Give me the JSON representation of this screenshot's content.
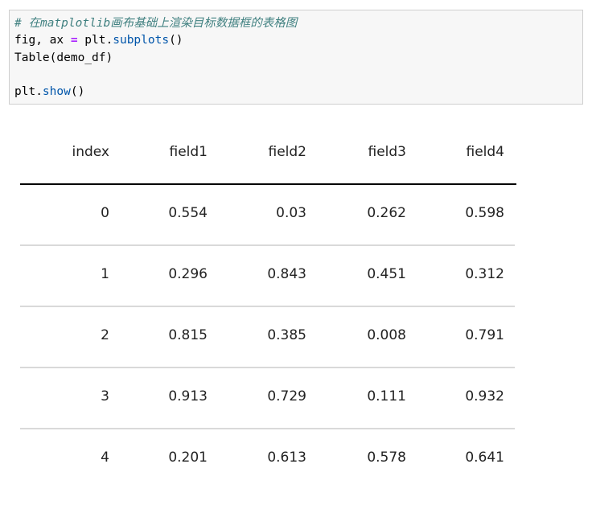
{
  "code": {
    "comment": "# 在matplotlib画布基础上渲染目标数据框的表格图",
    "line2_a": "fig, ax ",
    "line2_op": "=",
    "line2_b": " plt.",
    "line2_fn": "subplots",
    "line2_c": "()",
    "line3": "Table(demo_df)",
    "line5_a": "plt.",
    "line5_fn": "show",
    "line5_c": "()"
  },
  "table": {
    "headers": [
      "index",
      "field1",
      "field2",
      "field3",
      "field4"
    ],
    "rows": [
      [
        "0",
        "0.554",
        "0.03",
        "0.262",
        "0.598"
      ],
      [
        "1",
        "0.296",
        "0.843",
        "0.451",
        "0.312"
      ],
      [
        "2",
        "0.815",
        "0.385",
        "0.008",
        "0.791"
      ],
      [
        "3",
        "0.913",
        "0.729",
        "0.111",
        "0.932"
      ],
      [
        "4",
        "0.201",
        "0.613",
        "0.578",
        "0.641"
      ]
    ]
  }
}
